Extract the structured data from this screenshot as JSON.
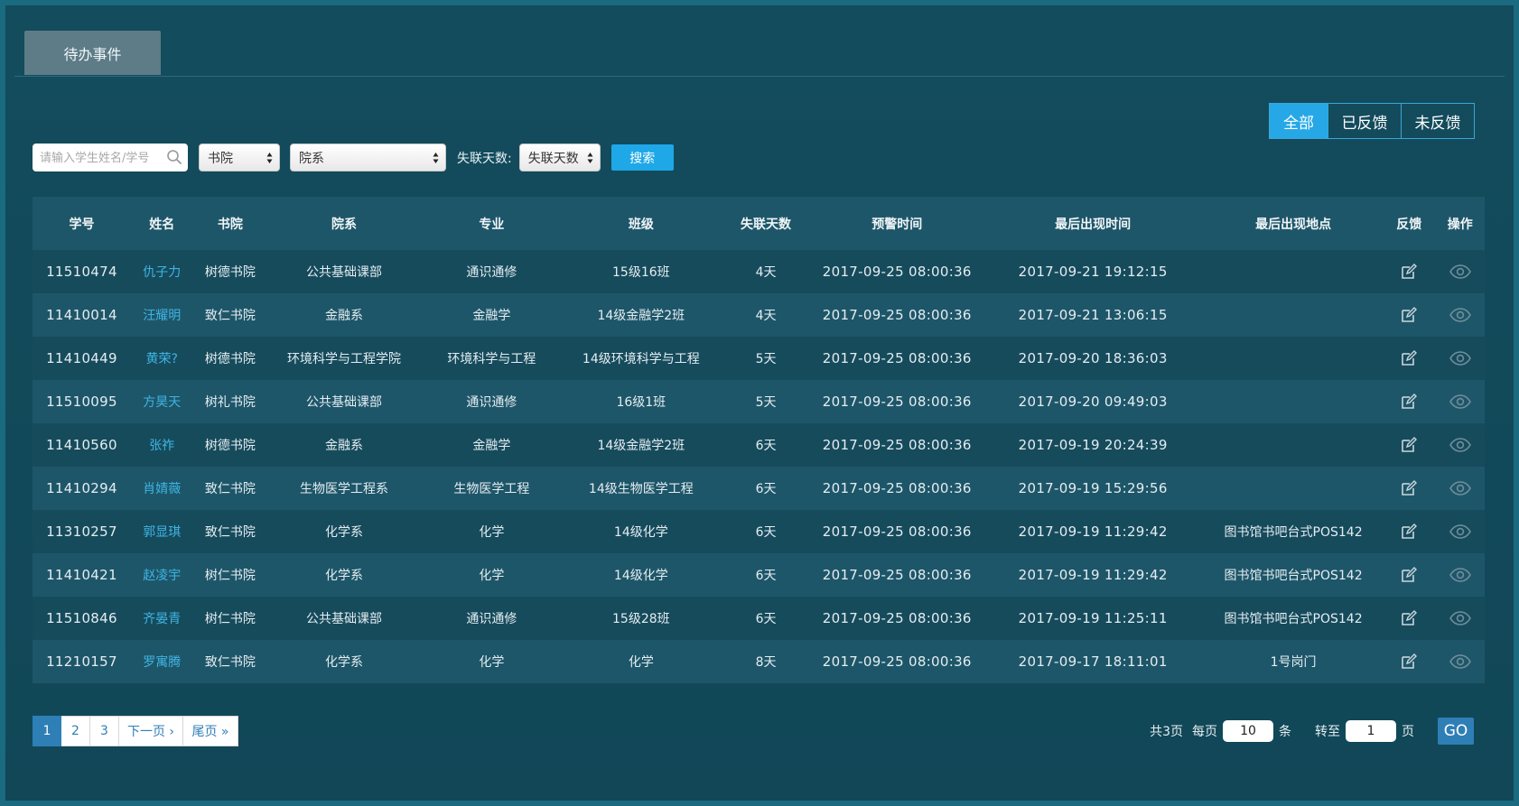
{
  "tabs": [
    {
      "label": "待办事件"
    }
  ],
  "filters": {
    "all": "全部",
    "fed_back": "已反馈",
    "not_fed_back": "未反馈",
    "active": "全部"
  },
  "search": {
    "placeholder": "请输入学生姓名/学号",
    "academy_select": "书院",
    "dept_select": "院系",
    "days_label": "失联天数:",
    "days_select": "失联天数",
    "button": "搜索"
  },
  "table": {
    "headers": [
      "学号",
      "姓名",
      "书院",
      "院系",
      "专业",
      "班级",
      "失联天数",
      "预警时间",
      "最后出现时间",
      "最后出现地点",
      "反馈",
      "操作"
    ],
    "rows": [
      [
        "11510474",
        "仇子力",
        "树德书院",
        "公共基础课部",
        "通识通修",
        "15级16班",
        "4天",
        "2017-09-25 08:00:36",
        "2017-09-21 19:12:15",
        ""
      ],
      [
        "11410014",
        "汪耀明",
        "致仁书院",
        "金融系",
        "金融学",
        "14级金融学2班",
        "4天",
        "2017-09-25 08:00:36",
        "2017-09-21 13:06:15",
        ""
      ],
      [
        "11410449",
        "黄荣?",
        "树德书院",
        "环境科学与工程学院",
        "环境科学与工程",
        "14级环境科学与工程",
        "5天",
        "2017-09-25 08:00:36",
        "2017-09-20 18:36:03",
        ""
      ],
      [
        "11510095",
        "方昊天",
        "树礼书院",
        "公共基础课部",
        "通识通修",
        "16级1班",
        "5天",
        "2017-09-25 08:00:36",
        "2017-09-20 09:49:03",
        ""
      ],
      [
        "11410560",
        "张祚",
        "树德书院",
        "金融系",
        "金融学",
        "14级金融学2班",
        "6天",
        "2017-09-25 08:00:36",
        "2017-09-19 20:24:39",
        ""
      ],
      [
        "11410294",
        "肖婧薇",
        "致仁书院",
        "生物医学工程系",
        "生物医学工程",
        "14级生物医学工程",
        "6天",
        "2017-09-25 08:00:36",
        "2017-09-19 15:29:56",
        ""
      ],
      [
        "11310257",
        "郭显琪",
        "致仁书院",
        "化学系",
        "化学",
        "14级化学",
        "6天",
        "2017-09-25 08:00:36",
        "2017-09-19 11:29:42",
        "图书馆书吧台式POS142"
      ],
      [
        "11410421",
        "赵凌宇",
        "树仁书院",
        "化学系",
        "化学",
        "14级化学",
        "6天",
        "2017-09-25 08:00:36",
        "2017-09-19 11:29:42",
        "图书馆书吧台式POS142"
      ],
      [
        "11510846",
        "齐晏青",
        "树仁书院",
        "公共基础课部",
        "通识通修",
        "15级28班",
        "6天",
        "2017-09-25 08:00:36",
        "2017-09-19 11:25:11",
        "图书馆书吧台式POS142"
      ],
      [
        "11210157",
        "罗寓腾",
        "致仁书院",
        "化学系",
        "化学",
        "化学",
        "8天",
        "2017-09-25 08:00:36",
        "2017-09-17 18:11:01",
        "1号岗门"
      ]
    ]
  },
  "pagination": {
    "pages": [
      "1",
      "2",
      "3"
    ],
    "current": "1",
    "next": "下一页 ›",
    "last": "尾页 »",
    "total_text": "共3页",
    "per_page_label": "每页",
    "per_page_value": "10",
    "per_page_unit": "条",
    "goto_label": "转至",
    "goto_value": "1",
    "goto_unit": "页",
    "go_button": "GO"
  },
  "icons": {
    "edit": "edit-icon",
    "view": "eye-icon",
    "search": "search-icon"
  },
  "colors": {
    "accent": "#27a8e6",
    "link": "#3fb4e3",
    "pager": "#2e7fb6"
  }
}
